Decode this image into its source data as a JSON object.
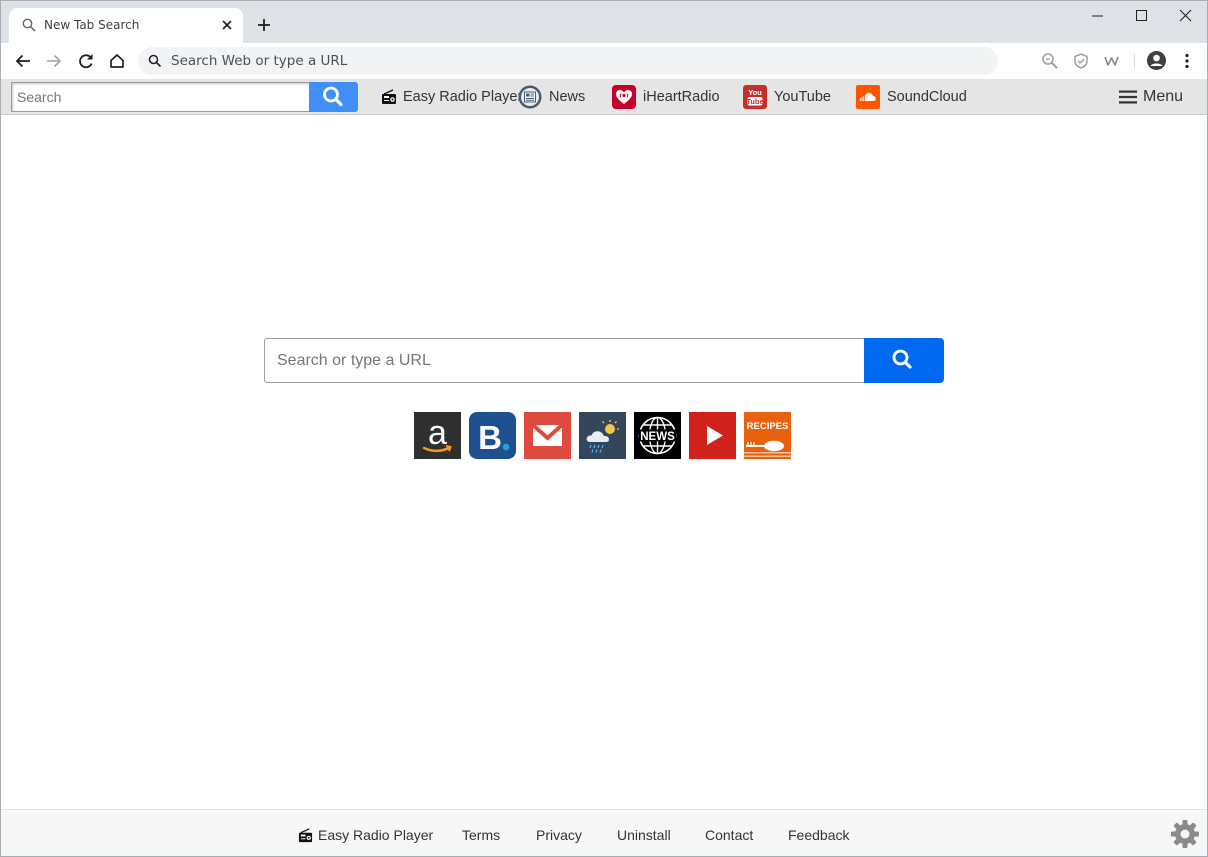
{
  "browser": {
    "tab_title": "New Tab Search",
    "omnibox_placeholder": "Search Web or type a URL"
  },
  "extension_bar": {
    "search_placeholder": "Search",
    "links": [
      {
        "label": "Easy Radio Player",
        "icon": "radio-icon"
      },
      {
        "label": "News",
        "icon": "news-icon"
      },
      {
        "label": "iHeartRadio",
        "icon": "iheartradio-icon"
      },
      {
        "label": "YouTube",
        "icon": "youtube-icon"
      },
      {
        "label": "SoundCloud",
        "icon": "soundcloud-icon"
      }
    ],
    "menu_label": "Menu"
  },
  "main": {
    "search_placeholder": "Search or type a URL",
    "tiles": [
      {
        "name": "amazon",
        "icon": "amazon-icon"
      },
      {
        "name": "booking",
        "icon": "booking-icon"
      },
      {
        "name": "gmail",
        "icon": "mail-icon"
      },
      {
        "name": "weather",
        "icon": "weather-icon"
      },
      {
        "name": "news",
        "icon": "globe-news-icon",
        "text": "NEWS"
      },
      {
        "name": "youtube",
        "icon": "play-icon"
      },
      {
        "name": "recipes",
        "icon": "recipes-icon",
        "text": "RECIPES"
      }
    ]
  },
  "footer": {
    "links": [
      {
        "label": "Easy Radio Player"
      },
      {
        "label": "Terms"
      },
      {
        "label": "Privacy"
      },
      {
        "label": "Uninstall"
      },
      {
        "label": "Contact"
      },
      {
        "label": "Feedback"
      }
    ]
  },
  "colors": {
    "search_button": "#0069f0",
    "ext_search_button": "#3f8ff5",
    "toolbar_bg": "#e5e5e5"
  }
}
